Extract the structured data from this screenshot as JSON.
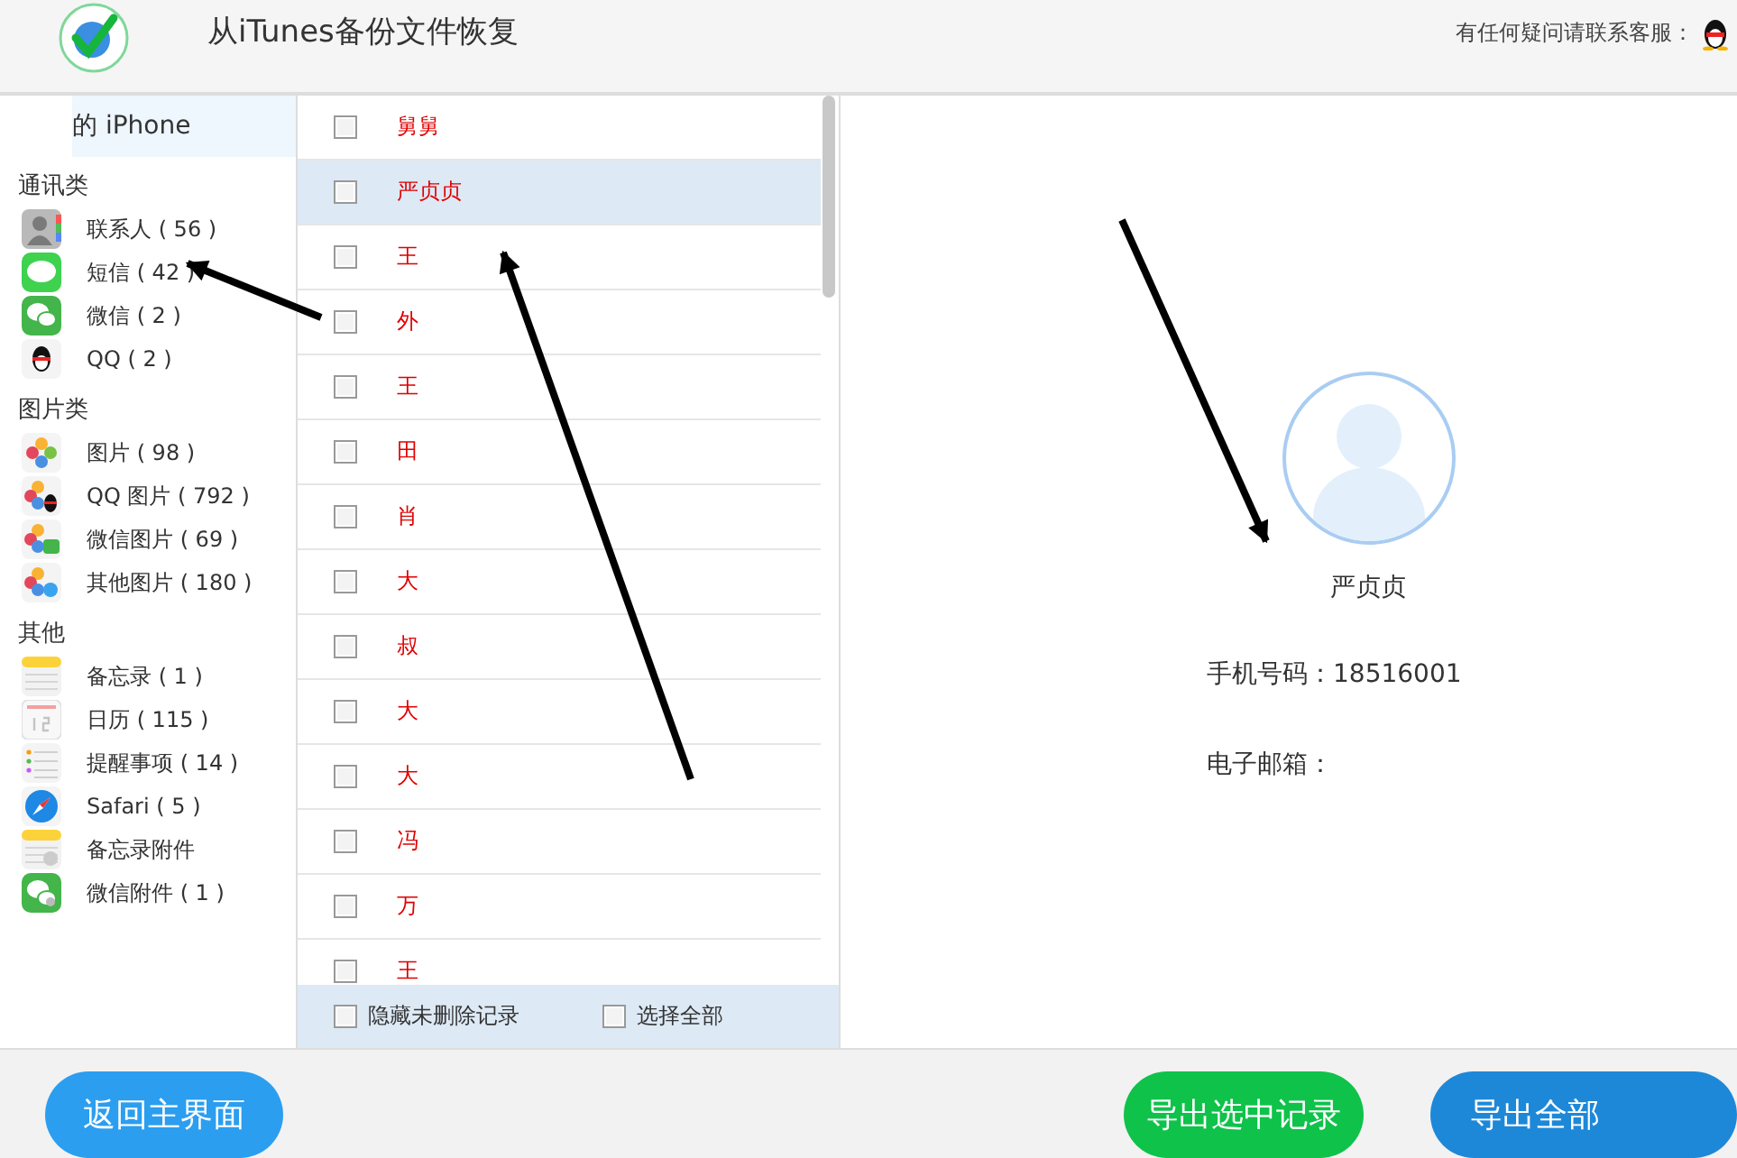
{
  "header": {
    "title": "从iTunes备份文件恢复",
    "support_text": "有任何疑问请联系客服："
  },
  "device": {
    "label": "的 iPhone",
    "selected": true
  },
  "sidebar": {
    "groups": [
      {
        "title": "通讯类",
        "items": [
          {
            "label": "联系人 ( 56 )",
            "kind": "contacts"
          },
          {
            "label": "短信 ( 42 )",
            "kind": "messages"
          },
          {
            "label": "微信 ( 2 )",
            "kind": "wechat"
          },
          {
            "label": "QQ ( 2 )",
            "kind": "qq"
          }
        ]
      },
      {
        "title": "图片类",
        "items": [
          {
            "label": "图片 ( 98 )",
            "kind": "photos"
          },
          {
            "label": "QQ 图片 ( 792 )",
            "kind": "qqphotos"
          },
          {
            "label": "微信图片 ( 69 )",
            "kind": "wechatphotos"
          },
          {
            "label": "其他图片 ( 180 )",
            "kind": "otherphotos"
          }
        ]
      },
      {
        "title": "其他",
        "items": [
          {
            "label": "备忘录 ( 1 )",
            "kind": "notes"
          },
          {
            "label": "日历 ( 115 )",
            "kind": "calendar"
          },
          {
            "label": "提醒事项 ( 14 )",
            "kind": "reminders"
          },
          {
            "label": "Safari ( 5 )",
            "kind": "safari"
          },
          {
            "label": "备忘录附件",
            "kind": "noteattachment"
          },
          {
            "label": "微信附件 ( 1 )",
            "kind": "wechatattachment"
          }
        ]
      }
    ]
  },
  "contacts": [
    {
      "name": "舅舅",
      "checked": false,
      "selected": false
    },
    {
      "name": "严贞贞",
      "checked": false,
      "selected": true
    },
    {
      "name": "王",
      "checked": false,
      "selected": false
    },
    {
      "name": "外",
      "checked": false,
      "selected": false
    },
    {
      "name": "王",
      "checked": false,
      "selected": false
    },
    {
      "name": "田",
      "checked": false,
      "selected": false
    },
    {
      "name": "肖",
      "checked": false,
      "selected": false
    },
    {
      "name": "大",
      "checked": false,
      "selected": false
    },
    {
      "name": "叔",
      "checked": false,
      "selected": false
    },
    {
      "name": "大",
      "checked": false,
      "selected": false
    },
    {
      "name": "大",
      "checked": false,
      "selected": false
    },
    {
      "name": "冯",
      "checked": false,
      "selected": false
    },
    {
      "name": "万",
      "checked": false,
      "selected": false
    },
    {
      "name": "王",
      "checked": false,
      "selected": false
    }
  ],
  "list_footer": [
    {
      "label": "隐藏未删除记录",
      "checked": false
    },
    {
      "label": "选择全部",
      "checked": false
    }
  ],
  "detail": {
    "name": "严贞贞",
    "fields": [
      {
        "label": "手机号码：",
        "value": "18516001"
      },
      {
        "label": "电子邮箱："
      }
    ]
  },
  "buttons": [
    {
      "label": "返回主界面",
      "kind": "back"
    },
    {
      "label": "导出选中记录",
      "kind": "exportselected"
    },
    {
      "label": "导出全部",
      "kind": "exportall"
    }
  ]
}
